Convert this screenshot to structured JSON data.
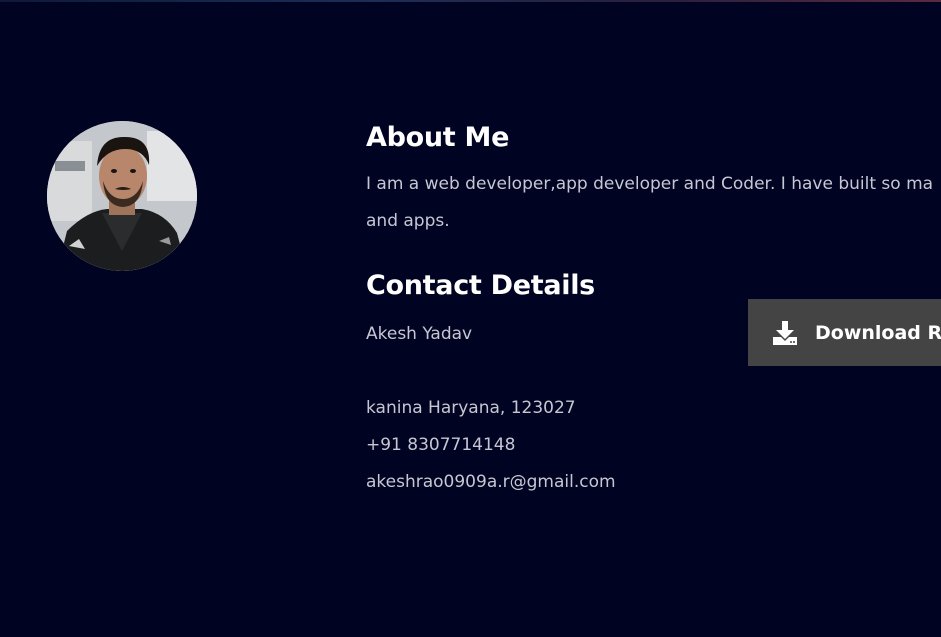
{
  "about": {
    "heading": "About Me",
    "text_line1": "I am a web developer,app developer and Coder. I have built so ma",
    "text_line2": "and apps."
  },
  "contact": {
    "heading": "Contact Details",
    "name": "Akesh Yadav",
    "address": "kanina Haryana, 123027",
    "phone": "+91 8307714148",
    "email": "akeshrao0909a.r@gmail.com"
  },
  "download": {
    "label": "Download Re",
    "icon": "download-icon"
  },
  "avatar": {
    "icon": "profile-photo"
  },
  "colors": {
    "background": "#010322",
    "button": "#444444",
    "text": "#c6c7d2",
    "heading": "#ffffff"
  }
}
